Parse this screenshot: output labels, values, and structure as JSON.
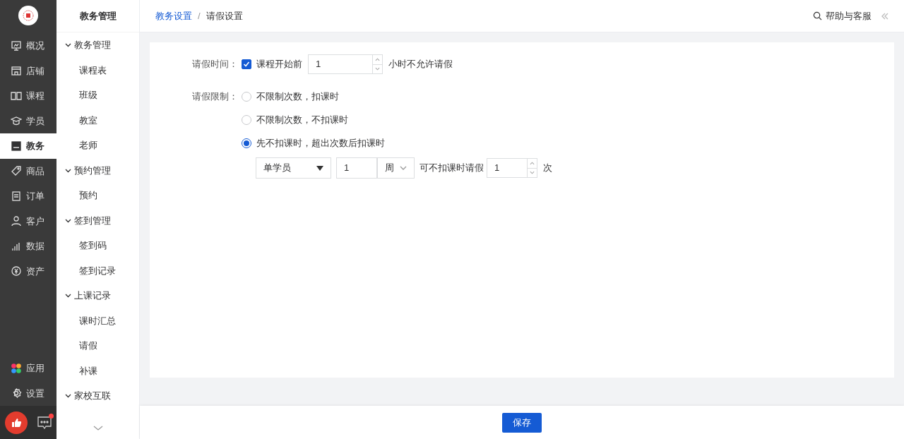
{
  "rail": {
    "items": [
      {
        "label": "概况",
        "selected": false
      },
      {
        "label": "店铺",
        "selected": false
      },
      {
        "label": "课程",
        "selected": false
      },
      {
        "label": "学员",
        "selected": false
      },
      {
        "label": "教务",
        "selected": true
      },
      {
        "label": "商品",
        "selected": false
      },
      {
        "label": "订单",
        "selected": false
      },
      {
        "label": "客户",
        "selected": false
      },
      {
        "label": "数据",
        "selected": false
      },
      {
        "label": "资产",
        "selected": false
      }
    ],
    "bottom_items": [
      {
        "label": "应用"
      },
      {
        "label": "设置"
      }
    ],
    "chat_badge": true
  },
  "submenu": {
    "title": "教务管理",
    "groups": [
      {
        "label": "教务管理",
        "expanded": true,
        "children": [
          {
            "label": "课程表"
          },
          {
            "label": "班级"
          },
          {
            "label": "教室"
          },
          {
            "label": "老师"
          }
        ]
      },
      {
        "label": "预约管理",
        "expanded": true,
        "children": [
          {
            "label": "预约"
          }
        ]
      },
      {
        "label": "签到管理",
        "expanded": true,
        "children": [
          {
            "label": "签到码"
          },
          {
            "label": "签到记录"
          }
        ]
      },
      {
        "label": "上课记录",
        "expanded": true,
        "children": [
          {
            "label": "课时汇总"
          },
          {
            "label": "请假"
          },
          {
            "label": "补课"
          }
        ]
      },
      {
        "label": "家校互联",
        "expanded": true
      }
    ]
  },
  "breadcrumb": [
    "教务设置",
    "请假设置"
  ],
  "breadcrumb_separator": "/",
  "help": "帮助与客服",
  "form": {
    "leave_time": {
      "label": "请假时间：",
      "checked": true,
      "text": "课程开始前",
      "value": "1",
      "suffix": "小时不允许请假"
    },
    "leave_limit": {
      "label": "请假限制：",
      "options": [
        {
          "label": "不限制次数，扣课时",
          "selected": false
        },
        {
          "label": "不限制次数，不扣课时",
          "selected": false
        },
        {
          "label": "先不扣课时，超出次数后扣课时",
          "selected": true
        }
      ],
      "scope": "单学员",
      "period_value": "1",
      "period_unit": "周",
      "middle_text": "可不扣课时请假",
      "count": "1",
      "count_unit": "次"
    }
  },
  "save_button": "保存"
}
